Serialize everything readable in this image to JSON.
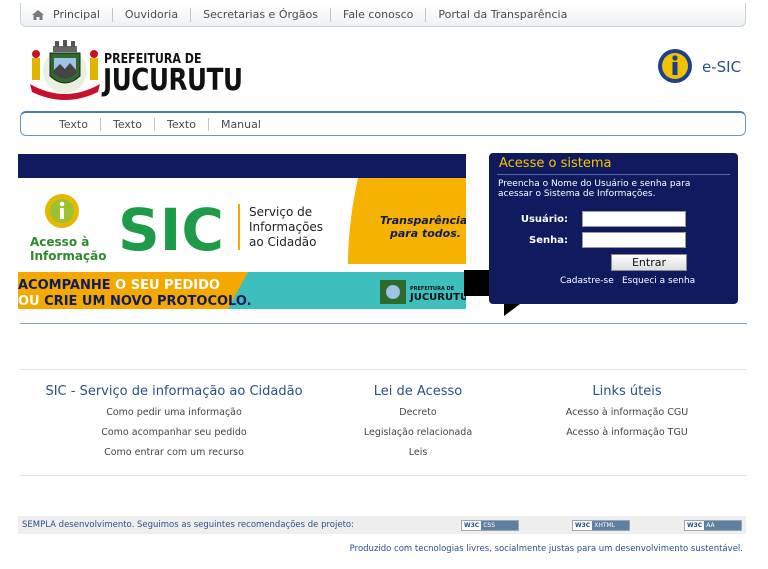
{
  "topnav": {
    "items": [
      "Principal",
      "Ouvidoria",
      "Secretarias e Órgãos",
      "Fale conosco",
      "Portal da Transparência"
    ]
  },
  "header": {
    "pref_small": "PREFEITURA DE",
    "pref_big": "JUCURUTU",
    "esic_label": "e-SIC"
  },
  "subnav": {
    "items": [
      "Texto",
      "Texto",
      "Texto",
      "Manual"
    ]
  },
  "banner": {
    "acesso": "Acesso à",
    "informacao": "Informação",
    "sic": "SIC",
    "servico1": "Serviço de",
    "servico2": "Informações",
    "servico3": "ao Cidadão",
    "transp1": "Transparência",
    "transp2": "para todos.",
    "acomp1a": "ACOMPANHE",
    "acomp1b": " O SEU PEDIDO",
    "acomp2a": "OU ",
    "acomp2b": "CRIE UM NOVO PROTOCOLO.",
    "mini_pref": "PREFEITURA DE",
    "mini_city": "JUCURUTU"
  },
  "login": {
    "title": "Acesse o sistema",
    "desc": "Preencha o Nome do Usuário e senha para acessar o Sistema de Informações.",
    "user_label": "Usuário:",
    "pass_label": "Senha:",
    "user_value": "",
    "pass_value": "",
    "enter_label": "Entrar",
    "register_link": "Cadastre-se",
    "forgot_link": "Esqueci a senha"
  },
  "footer_cols": [
    {
      "title": "SIC - Serviço de informação ao Cidadão",
      "items": [
        "Como pedir uma informação",
        "Como acompanhar seu pedido",
        "Como entrar com um recurso"
      ]
    },
    {
      "title": "Lei de Acesso",
      "items": [
        "Decreto",
        "Legislação relacionada",
        "Leis"
      ]
    },
    {
      "title": "Links úteis",
      "items": [
        "Acesso à informação CGU",
        "Acesso à informação TGU"
      ]
    }
  ],
  "bottombar": {
    "text": "SEMPLA desenvolvimento. Seguimos as seguintes recomendações de projeto:",
    "badges": [
      {
        "a": "W3C",
        "b": "CSS"
      },
      {
        "a": "W3C",
        "b": "XHTML"
      },
      {
        "a": "W3C",
        "b": "AA"
      }
    ]
  },
  "produced": "Produzido com tecnologias livres, socialmente justas para um desenvolvimento sustentável."
}
